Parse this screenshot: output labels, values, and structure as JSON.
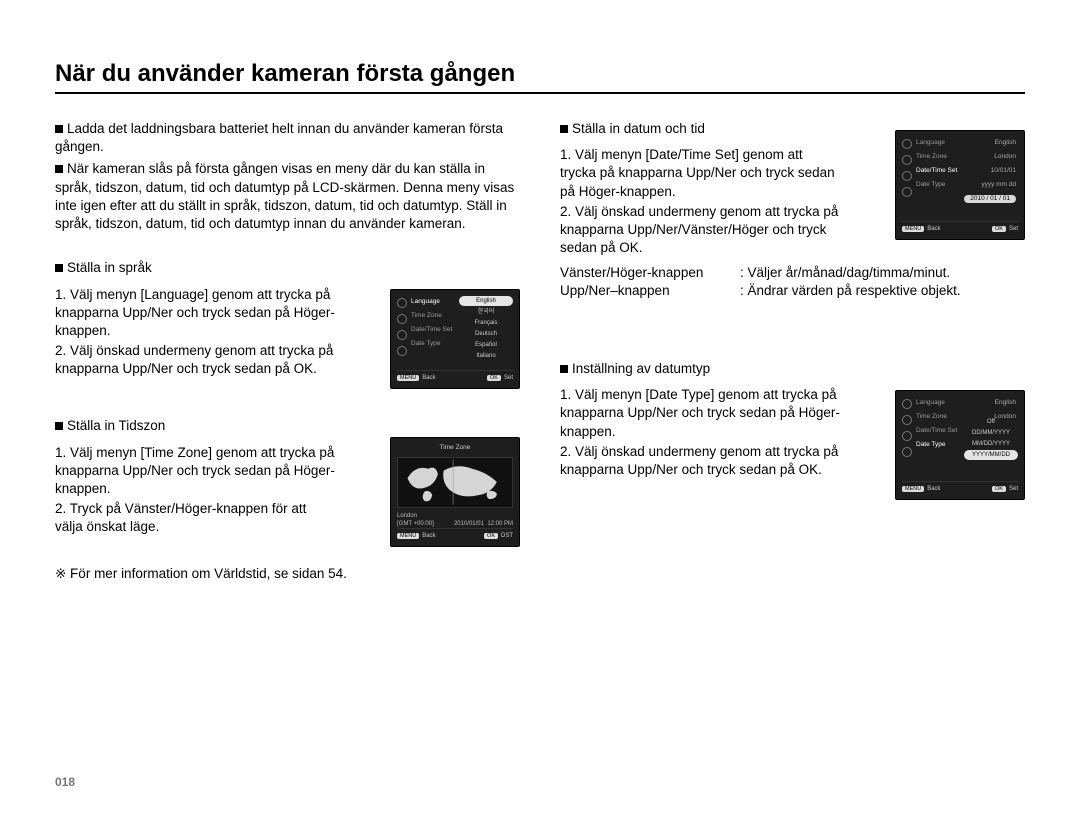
{
  "title": "När du använder kameran första gången",
  "page_number": "018",
  "intro1": "Ladda det laddningsbara batteriet helt innan du använder kameran första gången.",
  "intro2": "När kameran slås på första gången visas en meny där du kan ställa in språk, tidszon, datum, tid och datumtyp på LCD-skärmen. Denna meny visas inte igen efter att du ställt in språk, tidszon, datum, tid och datumtyp. Ställ in språk, tidszon, datum, tid och datumtyp innan du använder kameran.",
  "lang": {
    "head": "Ställa in språk",
    "step1": "1. Välj menyn [Language] genom att trycka på knapparna Upp/Ner och tryck sedan på Höger-knappen.",
    "step2": "2. Välj önskad undermeny genom att trycka på knapparna Upp/Ner och tryck sedan på OK."
  },
  "tz": {
    "head": "Ställa in Tidszon",
    "step1": "1. Välj menyn [Time Zone] genom att trycka på knapparna Upp/Ner och tryck sedan på Höger-knappen.",
    "step2": "2. Tryck på Vänster/Höger-knappen för att välja önskat läge."
  },
  "note": "※ För mer information om Världstid, se sidan 54.",
  "datetime": {
    "head": "Ställa in datum och tid",
    "step1": "1. Välj menyn [Date/Time Set] genom att trycka på knapparna Upp/Ner och tryck sedan på Höger-knappen.",
    "step2": "2. Välj önskad undermeny genom att trycka på knapparna Upp/Ner/Vänster/Höger och tryck sedan på OK.",
    "kv1k": "Vänster/Höger-knappen",
    "kv1v": ": Väljer år/månad/dag/timma/minut.",
    "kv2k": "Upp/Ner–knappen",
    "kv2v": ": Ändrar värden på respektive objekt."
  },
  "datetype": {
    "head": "Inställning av datumtyp",
    "step1": "1. Välj menyn [Date Type] genom att trycka på knapparna Upp/Ner och tryck sedan på Höger-knappen.",
    "step2": "2. Välj önskad undermeny genom att trycka på knapparna Upp/Ner och tryck sedan på OK."
  },
  "screens": {
    "footer_back": "Back",
    "footer_set": "Set",
    "footer_dst": "DST",
    "menu_labels": {
      "language": "Language",
      "timezone": "Time Zone",
      "datetimeset": "Date/Time Set",
      "datetype": "Date Type"
    },
    "lang_options": [
      "English",
      "한국어",
      "Français",
      "Deutsch",
      "Español",
      "Italiano"
    ],
    "dt_right_vals": {
      "lang": "English",
      "tz": "London",
      "dt": "10/01/01",
      "type": "yyyy mm dd",
      "typeline": "2010 / 01 / 01"
    },
    "tz_title": "Time Zone",
    "tz_city": "London",
    "tz_gmt": "[GMT +00:00]",
    "tz_date": "2010/01/01",
    "tz_time": "12:00 PM",
    "datetype_options": [
      "Off",
      "DD/MM/YYYY",
      "MM/DD/YYYY",
      "YYYY/MM/DD"
    ]
  }
}
